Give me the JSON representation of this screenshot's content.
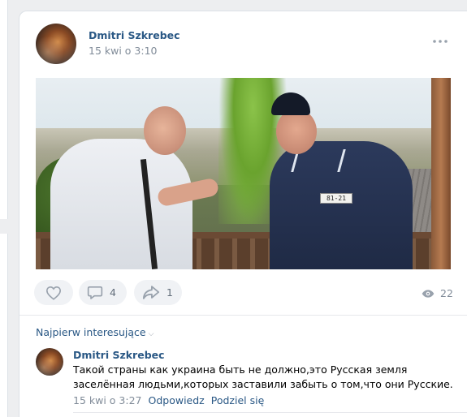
{
  "post": {
    "author": "Dmitri Szkrebec",
    "time": "15 kwi o 3:10",
    "more_icon": "more-horizontal-icon",
    "photo_badge": "81-21"
  },
  "actions": {
    "like_icon": "heart-icon",
    "comment_icon": "comment-icon",
    "comment_count": "4",
    "share_icon": "share-icon",
    "share_count": "1",
    "views_icon": "eye-icon",
    "views_count": "22"
  },
  "comments": {
    "sort_label": "Najpierw interesujące",
    "items": [
      {
        "author": "Dmitri Szkrebec",
        "text": "Такой страны как украина быть не должно,это Русская земля заселённая людьми,которых заставили забыть о том,что они Русские.",
        "time": "15 kwi o 3:27",
        "reply_label": "Odpowiedz",
        "share_label": "Podziel się"
      }
    ]
  },
  "colors": {
    "link": "#2a5885",
    "secondary_text": "#818c99",
    "button_bg": "#f0f2f5",
    "icon": "#99a2ad"
  }
}
